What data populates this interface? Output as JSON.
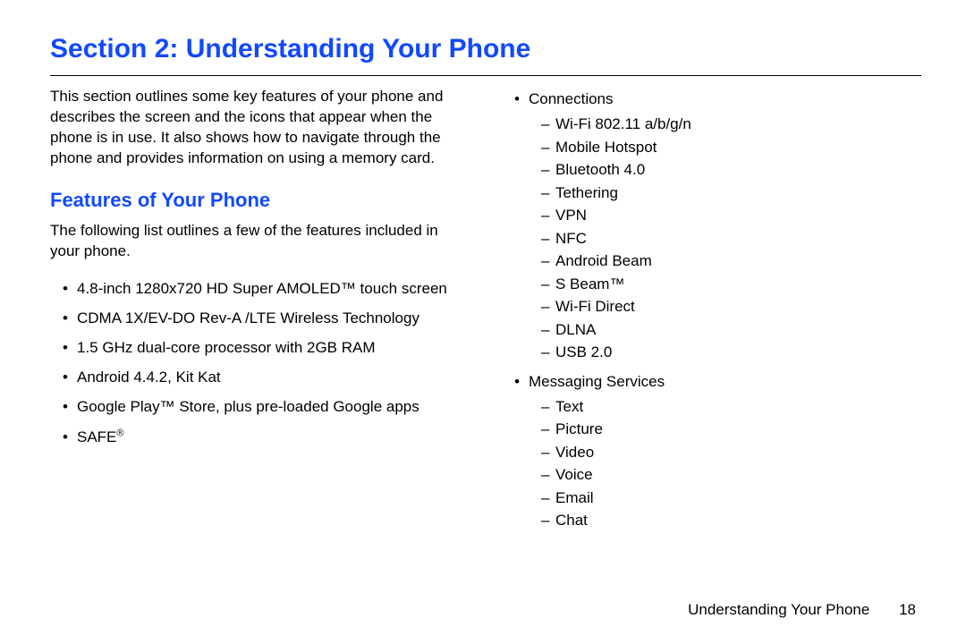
{
  "section_title": "Section 2: Understanding Your Phone",
  "intro": "This section outlines some key features of your phone and describes the screen and the icons that appear when the phone is in use. It also shows how to navigate through the phone and provides information on using a memory card.",
  "features_heading": "Features of Your Phone",
  "features_lead": "The following list outlines a few of the features included in your phone.",
  "left_bullets": [
    "4.8-inch 1280x720 HD Super AMOLED™ touch screen",
    "CDMA 1X/EV-DO Rev-A /LTE Wireless Technology",
    "1.5 GHz dual-core processor with 2GB RAM",
    "Android 4.4.2, Kit Kat",
    "Google Play™ Store, plus pre-loaded Google apps",
    "SAFE®"
  ],
  "right_bullets": [
    {
      "label": "Connections",
      "sub": [
        "Wi-Fi 802.11 a/b/g/n",
        "Mobile Hotspot",
        "Bluetooth 4.0",
        "Tethering",
        "VPN",
        "NFC",
        "Android Beam",
        "S Beam™",
        "Wi-Fi Direct",
        "DLNA",
        "USB 2.0"
      ]
    },
    {
      "label": "Messaging Services",
      "sub": [
        "Text",
        "Picture",
        "Video",
        "Voice",
        "Email",
        "Chat"
      ]
    }
  ],
  "footer_title": "Understanding Your Phone",
  "footer_page": "18"
}
